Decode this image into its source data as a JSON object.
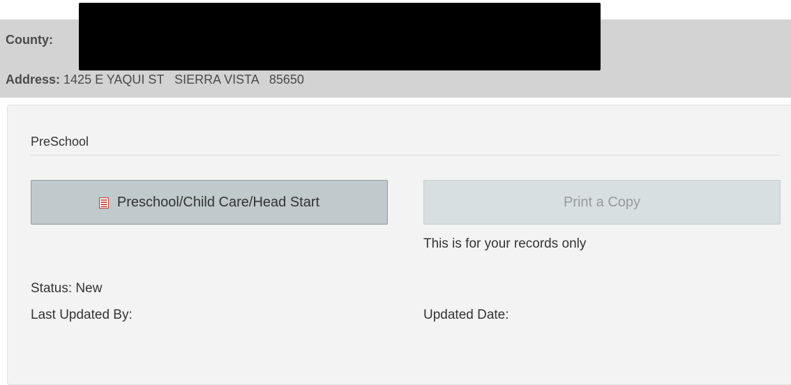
{
  "header": {
    "county_label": "County:",
    "county_value": "",
    "address_label": "Address:",
    "address_value": " 1425 E YAQUI ST   SIERRA VISTA   85650"
  },
  "section": {
    "title": "PreSchool"
  },
  "buttons": {
    "form_label": "Preschool/Child Care/Head Start",
    "form_icon": "form-icon",
    "print_label": "Print a Copy"
  },
  "note": "This is for your records only",
  "meta": {
    "status": "Status: New",
    "last_updated_by": "Last Updated By:",
    "updated_date": "Updated Date:"
  },
  "colors": {
    "header_bg": "#d3d3d3",
    "panel_bg": "#f3f3f3",
    "primary_button_bg": "#c0c9cb",
    "disabled_button_bg": "#d7dfe0",
    "icon_red": "#c23b3b"
  }
}
